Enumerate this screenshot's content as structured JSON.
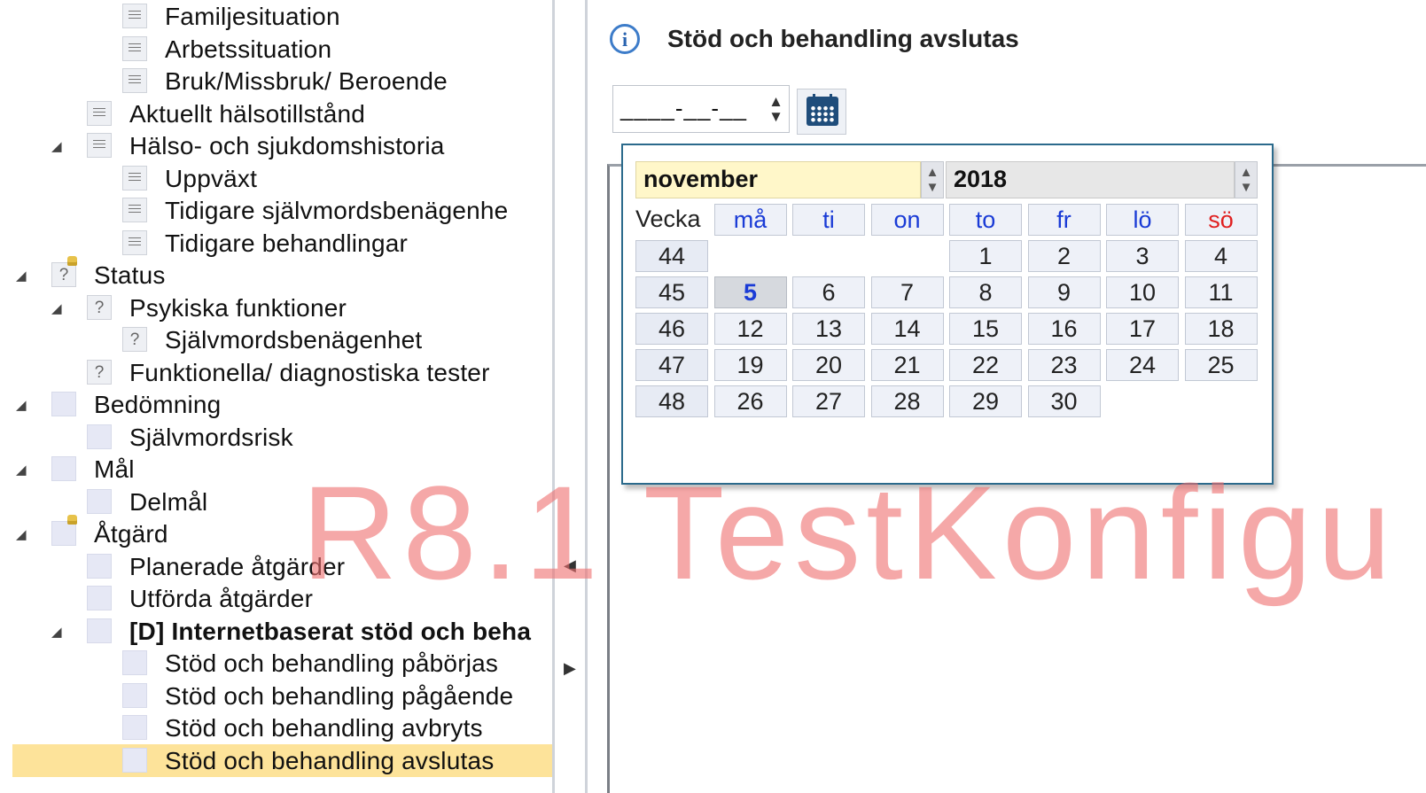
{
  "tree": {
    "items": [
      {
        "label": "Familjesituation",
        "icon": "document-icon",
        "level": 3,
        "expanded": null
      },
      {
        "label": "Arbetssituation",
        "icon": "document-icon",
        "level": 3,
        "expanded": null
      },
      {
        "label": "Bruk/Missbruk/ Beroende",
        "icon": "document-icon",
        "level": 3,
        "expanded": null
      },
      {
        "label": "Aktuellt hälsotillstånd",
        "icon": "document-icon",
        "level": 2,
        "expanded": null
      },
      {
        "label": "Hälso- och sjukdomshistoria",
        "icon": "document-icon",
        "level": 2,
        "expanded": true
      },
      {
        "label": "Uppväxt",
        "icon": "document-icon",
        "level": 3,
        "expanded": null
      },
      {
        "label": "Tidigare självmordsbenägenhe",
        "icon": "document-icon",
        "level": 3,
        "expanded": null
      },
      {
        "label": "Tidigare behandlingar",
        "icon": "document-icon",
        "level": 3,
        "expanded": null
      },
      {
        "label": "Status",
        "icon": "locked-question-icon",
        "level": 1,
        "expanded": true
      },
      {
        "label": "Psykiska funktioner",
        "icon": "question-icon",
        "level": 2,
        "expanded": true
      },
      {
        "label": "Självmordsbenägenhet",
        "icon": "question-icon",
        "level": 3,
        "expanded": null
      },
      {
        "label": "Funktionella/ diagnostiska tester",
        "icon": "question-icon",
        "level": 2,
        "expanded": null
      },
      {
        "label": "Bedömning",
        "icon": "blank-icon",
        "level": 1,
        "expanded": true
      },
      {
        "label": "Självmordsrisk",
        "icon": "blank-icon",
        "level": 2,
        "expanded": null
      },
      {
        "label": "Mål",
        "icon": "blank-icon",
        "level": 1,
        "expanded": true
      },
      {
        "label": "Delmål",
        "icon": "blank-icon",
        "level": 2,
        "expanded": null
      },
      {
        "label": "Åtgärd",
        "icon": "locked-blank-icon",
        "level": 1,
        "expanded": true
      },
      {
        "label": "Planerade åtgärder",
        "icon": "blank-icon",
        "level": 2,
        "expanded": null
      },
      {
        "label": "Utförda åtgärder",
        "icon": "blank-icon",
        "level": 2,
        "expanded": null
      },
      {
        "label": "[D] Internetbaserat stöd och beha",
        "icon": "blank-icon",
        "level": 2,
        "expanded": true,
        "bold": true
      },
      {
        "label": "Stöd och behandling påbörjas",
        "icon": "blank-icon",
        "level": 3,
        "expanded": null
      },
      {
        "label": "Stöd och behandling pågående",
        "icon": "blank-icon",
        "level": 3,
        "expanded": null
      },
      {
        "label": "Stöd och behandling avbryts",
        "icon": "blank-icon",
        "level": 3,
        "expanded": null
      },
      {
        "label": "Stöd och behandling avslutas",
        "icon": "blank-icon",
        "level": 3,
        "expanded": null,
        "selected": true
      }
    ]
  },
  "splitter": {
    "collapse_icon": "triangle-left-icon",
    "expand_icon": "triangle-right-icon"
  },
  "form": {
    "title": "Stöd och behandling avslutas",
    "title_icon": "info-icon",
    "date_value": "____-__-__",
    "calendar_button_icon": "calendar-icon"
  },
  "calendar": {
    "month": "november",
    "year": "2018",
    "week_header": "Vecka",
    "weekdays": [
      "må",
      "ti",
      "on",
      "to",
      "fr",
      "lö",
      "sö"
    ],
    "weeks": [
      {
        "week": "44",
        "days": [
          "",
          "",
          "",
          "1",
          "2",
          "3",
          "4"
        ]
      },
      {
        "week": "45",
        "days": [
          "5",
          "6",
          "7",
          "8",
          "9",
          "10",
          "11"
        ]
      },
      {
        "week": "46",
        "days": [
          "12",
          "13",
          "14",
          "15",
          "16",
          "17",
          "18"
        ]
      },
      {
        "week": "47",
        "days": [
          "19",
          "20",
          "21",
          "22",
          "23",
          "24",
          "25"
        ]
      },
      {
        "week": "48",
        "days": [
          "26",
          "27",
          "28",
          "29",
          "30",
          "",
          ""
        ]
      }
    ],
    "highlighted_day": "5",
    "colors": {
      "weekday_header": "#1a3bd6",
      "sunday_header": "#e02020",
      "month_field": "#fff7c9"
    }
  },
  "watermark": "R8.1  TestKonfigu"
}
